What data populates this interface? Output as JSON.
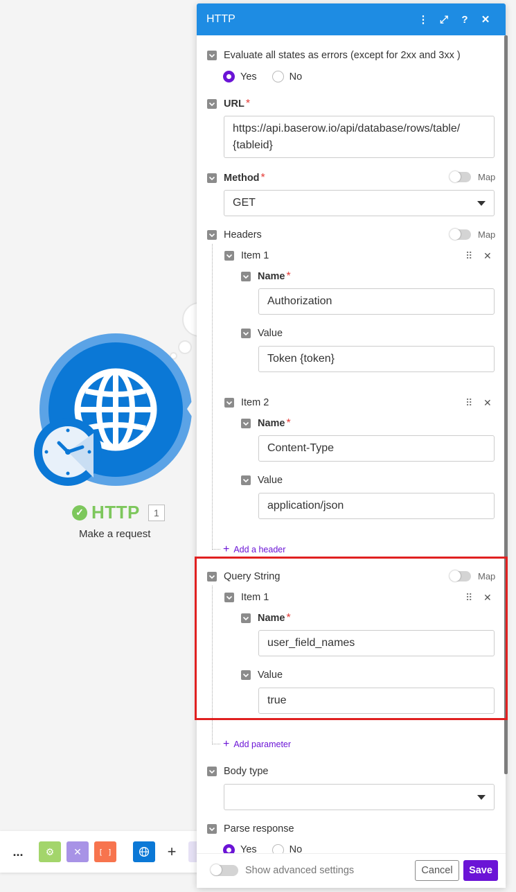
{
  "module": {
    "title": "HTTP",
    "number": "1",
    "subtitle": "Make a request",
    "brand_color": "#0b78d6",
    "status_color": "#7dc75c"
  },
  "toolbar": {
    "more": "...",
    "bracket": "[ ]",
    "plus": "+"
  },
  "panel": {
    "title": "HTTP",
    "header_icons": [
      "more-vertical-icon",
      "expand-icon",
      "help-icon",
      "close-icon"
    ],
    "evaluate_errors": {
      "label": "Evaluate all states as errors (except for 2xx and 3xx )",
      "options": [
        "Yes",
        "No"
      ],
      "selected": "Yes"
    },
    "url": {
      "label": "URL",
      "value_line1": "https://api.baserow.io/api/database/rows/table/",
      "value_line2": "{tableid}"
    },
    "method": {
      "label": "Method",
      "map_label": "Map",
      "value": "GET"
    },
    "headers": {
      "label": "Headers",
      "map_label": "Map",
      "items": [
        {
          "label": "Item 1",
          "name_label": "Name",
          "name_value": "Authorization",
          "value_label": "Value",
          "value_value": "Token {token}"
        },
        {
          "label": "Item 2",
          "name_label": "Name",
          "name_value": "Content-Type",
          "value_label": "Value",
          "value_value": "application/json"
        }
      ],
      "add_label": "Add a header"
    },
    "query_string": {
      "label": "Query String",
      "map_label": "Map",
      "items": [
        {
          "label": "Item 1",
          "name_label": "Name",
          "name_value": "user_field_names",
          "value_label": "Value",
          "value_value": "true"
        }
      ],
      "add_label": "Add parameter"
    },
    "body_type": {
      "label": "Body type",
      "value": ""
    },
    "parse_response": {
      "label": "Parse response",
      "options": [
        "Yes",
        "No"
      ],
      "selected": "Yes"
    },
    "footer": {
      "advanced_label": "Show advanced settings",
      "cancel_label": "Cancel",
      "save_label": "Save"
    },
    "accent_color": "#6b14d6",
    "header_color": "#1e8ce3"
  }
}
